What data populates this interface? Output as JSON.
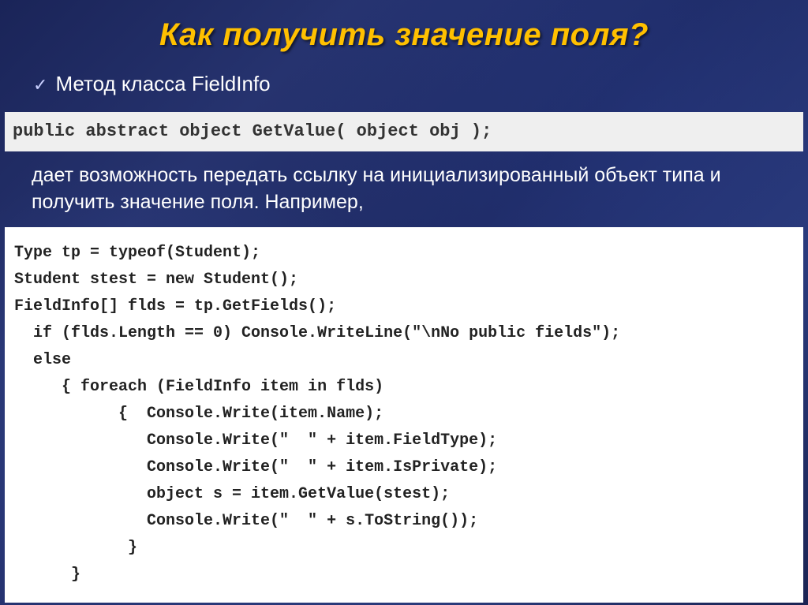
{
  "title": "Как получить значение поля?",
  "bullet_text": "Метод класса FieldInfo",
  "signature_code": "public abstract object GetValue( object obj );",
  "description": "дает возможность передать ссылку на инициализированный объект типа и получить значение поля. Например,",
  "example_code": "Type tp = typeof(Student);\nStudent stest = new Student();\nFieldInfo[] flds = tp.GetFields();\n  if (flds.Length == 0) Console.WriteLine(\"\\nNo public fields\");\n  else\n     { foreach (FieldInfo item in flds)\n           {  Console.Write(item.Name);\n              Console.Write(\"  \" + item.FieldType);\n              Console.Write(\"  \" + item.IsPrivate);\n              object s = item.GetValue(stest);\n              Console.Write(\"  \" + s.ToString());\n            }\n      }"
}
